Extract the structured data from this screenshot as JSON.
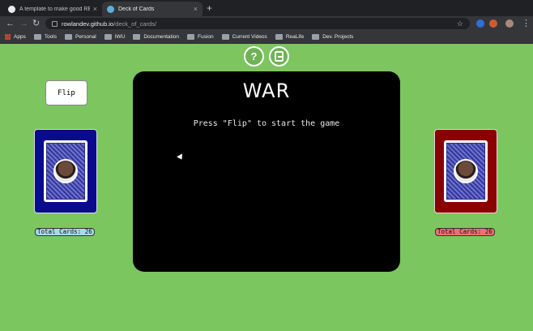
{
  "browser": {
    "tabs": [
      {
        "title": "A template to make good REA",
        "active": false
      },
      {
        "title": "Deck of Cards",
        "active": true
      }
    ],
    "new_tab": "+",
    "close_glyph": "×",
    "url_host": "rowlandev.github.io",
    "url_path": "/deck_of_cards/",
    "bookmarks": [
      "Apps",
      "Tools",
      "Personal",
      "IWU",
      "Documentation",
      "Fusion",
      "Current Videos",
      "ReaLife",
      "Dev. Projects"
    ]
  },
  "game": {
    "help_label": "?",
    "flip_label": "Flip",
    "title": "WAR",
    "message": "Press \"Flip\" to start the game",
    "player_count": "Total Cards: 26",
    "opponent_count": "Total Cards: 26",
    "colors": {
      "player_card": "#0a0a8c",
      "opponent_card": "#8b0000",
      "background": "#7bc55f",
      "board": "#000000"
    }
  }
}
